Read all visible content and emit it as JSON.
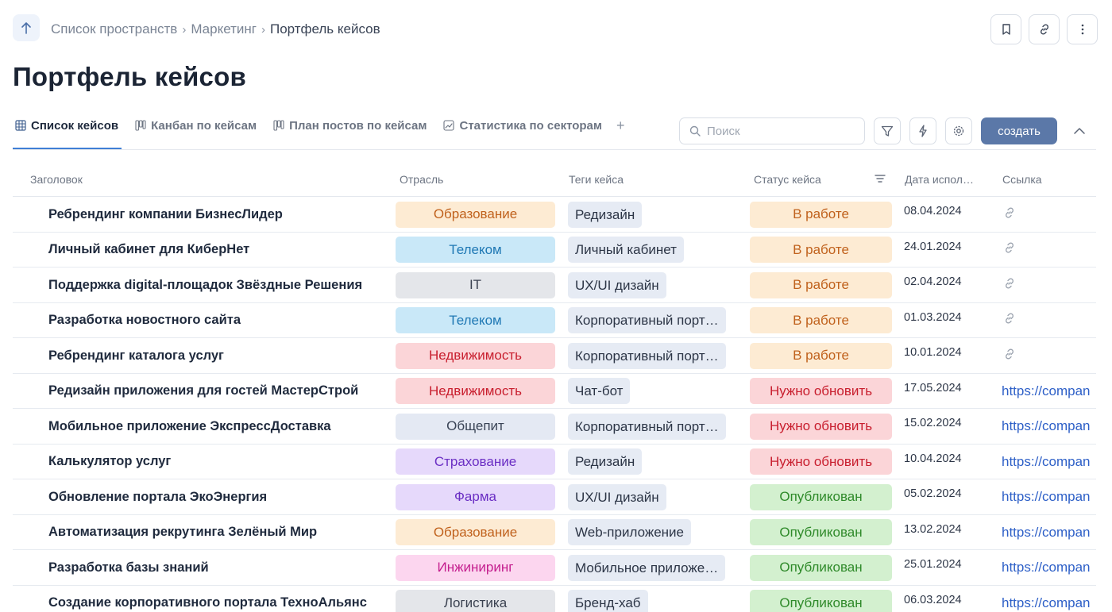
{
  "breadcrumb": {
    "items": [
      "Список пространств",
      "Маркетинг"
    ],
    "current": "Портфель кейсов",
    "separator": "›"
  },
  "page_title": "Портфель кейсов",
  "tabs": [
    {
      "label": "Список кейсов",
      "icon": "grid-icon",
      "active": true
    },
    {
      "label": "Канбан по кейсам",
      "icon": "kanban-icon",
      "active": false
    },
    {
      "label": "План постов по кейсам",
      "icon": "kanban-icon",
      "active": false
    },
    {
      "label": "Статистика по секторам",
      "icon": "chart-icon",
      "active": false
    }
  ],
  "tab_add": "+",
  "search": {
    "placeholder": "Поиск",
    "value": ""
  },
  "create_label": "создать",
  "columns": {
    "title": "Заголовок",
    "industry": "Отрасль",
    "tags": "Теги кейса",
    "status": "Статус кейса",
    "date": "Дата испол…",
    "link": "Ссылка"
  },
  "colors": {
    "accent": "#3f7fd6",
    "create_button": "#5b78a8",
    "link": "#2d5fc7"
  },
  "industry_styles": {
    "Образование": {
      "bg": "#fdebd3",
      "fg": "#c0611c"
    },
    "Телеком": {
      "bg": "#c9e8f8",
      "fg": "#1f78b4"
    },
    "IT": {
      "bg": "#e4e6ea",
      "fg": "#3a4150"
    },
    "Недвижимость": {
      "bg": "#fbd5d8",
      "fg": "#c81e2e"
    },
    "Общепит": {
      "bg": "#e4e9f3",
      "fg": "#3a4456"
    },
    "Страхование": {
      "bg": "#e6d9fb",
      "fg": "#6b2fc4"
    },
    "Фарма": {
      "bg": "#e6d9fb",
      "fg": "#6b2fc4"
    },
    "Инжиниринг": {
      "bg": "#fcd6ef",
      "fg": "#c41e8e"
    },
    "Логистика": {
      "bg": "#e4e6ea",
      "fg": "#3a4150"
    }
  },
  "status_styles": {
    "В работе": {
      "bg": "#fdebd3",
      "fg": "#c0611c"
    },
    "Нужно обновить": {
      "bg": "#fbd5d8",
      "fg": "#c81e2e"
    },
    "Опубликован": {
      "bg": "#d3f0cf",
      "fg": "#2f8a2a"
    }
  },
  "rows": [
    {
      "title": "Ребрендинг компании БизнесЛидер",
      "industry": "Образование",
      "tag": "Редизайн",
      "status": "В работе",
      "date": "08.04.2024",
      "link": ""
    },
    {
      "title": "Личный кабинет для КиберНет",
      "industry": "Телеком",
      "tag": "Личный кабинет",
      "status": "В работе",
      "date": "24.01.2024",
      "link": ""
    },
    {
      "title": "Поддержка digital-площадок Звёздные Решения",
      "industry": "IT",
      "tag": "UX/UI дизайн",
      "status": "В работе",
      "date": "02.04.2024",
      "link": ""
    },
    {
      "title": "Разработка новостного сайта",
      "industry": "Телеком",
      "tag": "Корпоративный порт…",
      "status": "В работе",
      "date": "01.03.2024",
      "link": ""
    },
    {
      "title": "Ребрендинг каталога услуг",
      "industry": "Недвижимость",
      "tag": "Корпоративный порт…",
      "status": "В работе",
      "date": "10.01.2024",
      "link": ""
    },
    {
      "title": "Редизайн приложения для гостей МастерСтрой",
      "industry": "Недвижимость",
      "tag": "Чат-бот",
      "status": "Нужно обновить",
      "date": "17.05.2024",
      "link": "https://compan"
    },
    {
      "title": "Мобильное приложение ЭкспрессДоставка",
      "industry": "Общепит",
      "tag": "Корпоративный порт…",
      "status": "Нужно обновить",
      "date": "15.02.2024",
      "link": "https://compan"
    },
    {
      "title": "Калькулятор услуг",
      "industry": "Страхование",
      "tag": "Редизайн",
      "status": "Нужно обновить",
      "date": "10.04.2024",
      "link": "https://compan"
    },
    {
      "title": "Обновление портала ЭкоЭнергия",
      "industry": "Фарма",
      "tag": "UX/UI дизайн",
      "status": "Опубликован",
      "date": "05.02.2024",
      "link": "https://compan"
    },
    {
      "title": "Автоматизация рекрутинга Зелёный Мир",
      "industry": "Образование",
      "tag": "Web-приложение",
      "status": "Опубликован",
      "date": "13.02.2024",
      "link": "https://compan"
    },
    {
      "title": "Разработка базы знаний",
      "industry": "Инжиниринг",
      "tag": "Мобильное приложе…",
      "status": "Опубликован",
      "date": "25.01.2024",
      "link": "https://compan"
    },
    {
      "title": "Создание корпоративного портала ТехноАльянс",
      "industry": "Логистика",
      "tag": "Бренд-хаб",
      "status": "Опубликован",
      "date": "06.03.2024",
      "link": "https://compan"
    }
  ]
}
